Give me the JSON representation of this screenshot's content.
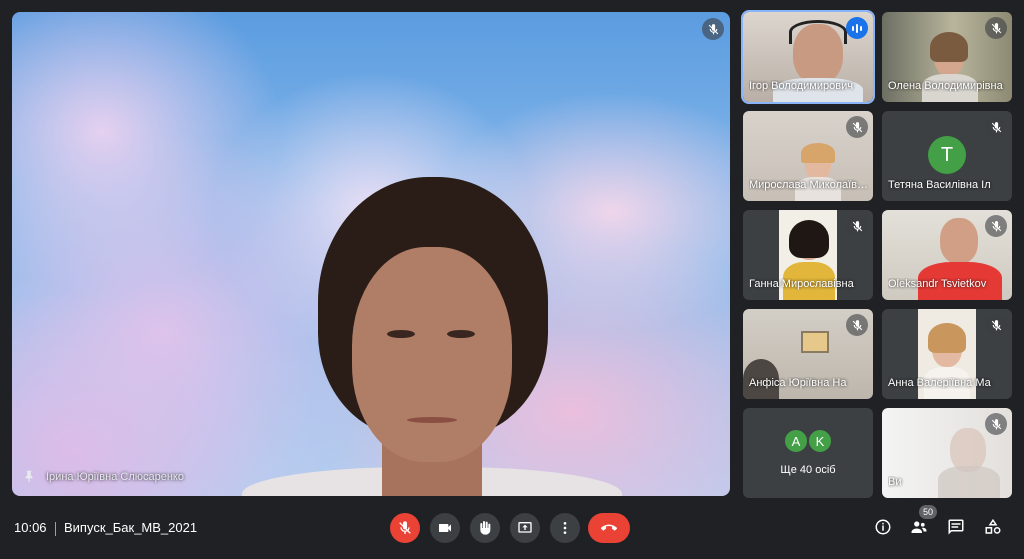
{
  "main_speaker": {
    "name": "Ірина Юріївна Слюсаренко"
  },
  "participants": [
    {
      "name": "Ігор Володимирович",
      "speaking": true
    },
    {
      "name": "Олена Володимирівна"
    },
    {
      "name": "Мирослава Миколаївна"
    },
    {
      "name": "Тетяна Василівна Іл",
      "avatar_letter": "T",
      "avatar_color": "#43a047"
    },
    {
      "name": "Ганна Мирославівна"
    },
    {
      "name": "Oleksandr Tsvietkov"
    },
    {
      "name": "Анфіса Юріївна На"
    },
    {
      "name": "Анна Валеріївна Ма"
    },
    {
      "name": "Ви"
    }
  ],
  "more_tile": {
    "label": "Ще 40 осіб",
    "avatars": [
      {
        "letter": "A",
        "color": "#43a047"
      },
      {
        "letter": "K",
        "color": "#43a047"
      }
    ]
  },
  "toolbar": {
    "time": "10:06",
    "meeting_name": "Випуск_Бак_МВ_2021",
    "people_count": "50"
  },
  "colors": {
    "accent": "#8ab4f8",
    "end_call": "#ea4335",
    "speaking": "#1a73e8"
  }
}
